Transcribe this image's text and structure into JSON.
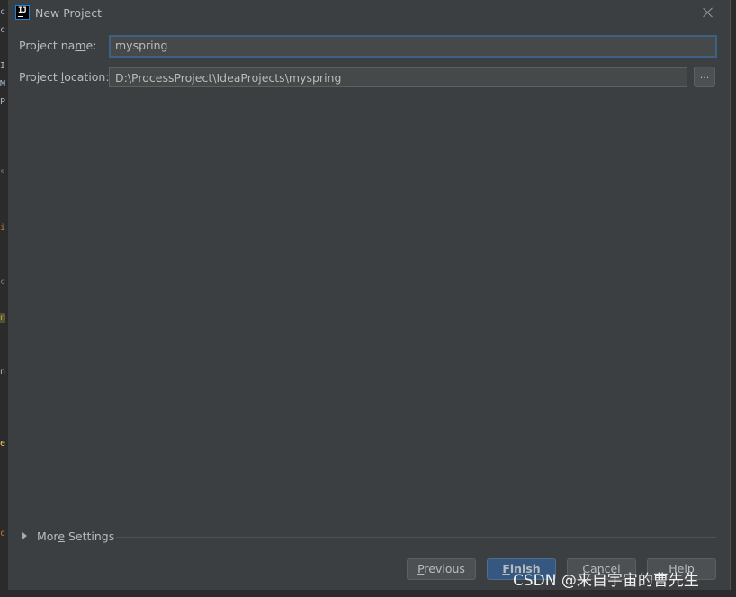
{
  "background_editor_fragments": [
    "c",
    "c",
    "I",
    "M",
    "P",
    "s",
    "i",
    "c",
    "n",
    "n",
    "e",
    "c"
  ],
  "dialog": {
    "title": "New Project",
    "icon_name": "intellij-idea-icon",
    "icon_text": "IJ"
  },
  "form": {
    "project_name": {
      "label_pre": "Project na",
      "label_mn": "m",
      "label_post": "e:",
      "value": "myspring"
    },
    "project_location": {
      "label_pre": "Project ",
      "label_mn": "l",
      "label_post": "ocation:",
      "value": "D:\\ProcessProject\\IdeaProjects\\myspring",
      "browse_label": "..."
    }
  },
  "more_settings": {
    "pre": "Mor",
    "mn": "e",
    "post": " Settings"
  },
  "buttons": {
    "previous": {
      "mn": "P",
      "post": "revious"
    },
    "finish": {
      "mn": "F",
      "post": "inish"
    },
    "cancel": "Cancel",
    "help": "Help"
  },
  "watermark": "CSDN @来自宇宙的曹先生",
  "colors": {
    "dialog_bg": "#3c3f41",
    "input_bg": "#45494a",
    "focus_border": "#3d6185",
    "primary_button": "#365880",
    "text": "#bbbbbb"
  }
}
